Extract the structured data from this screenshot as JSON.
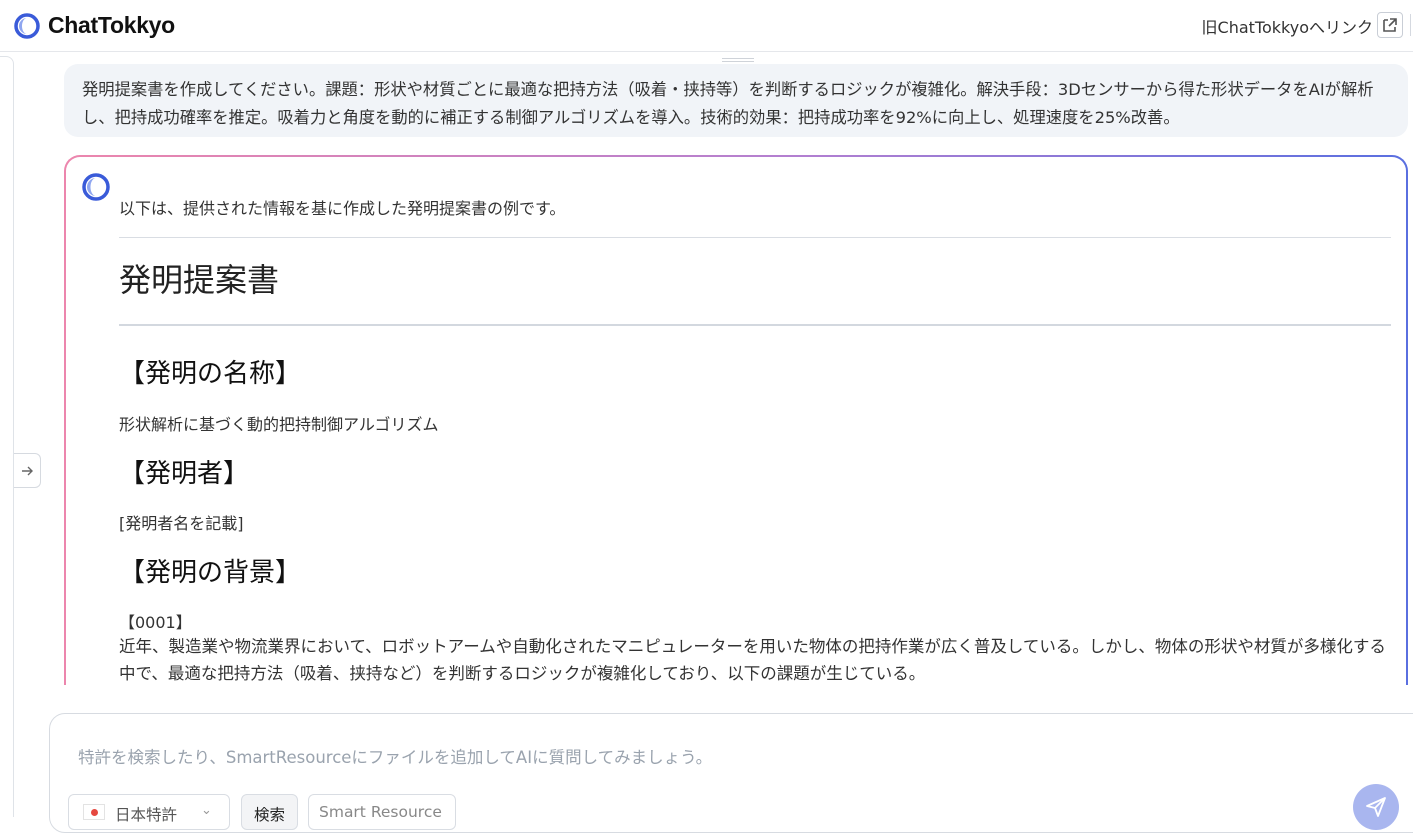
{
  "header": {
    "app_name": "ChatTokkyo",
    "old_link_label": "旧ChatTokkyoへリンク"
  },
  "user_message": {
    "text": "発明提案書を作成してください。課題：形状や材質ごとに最適な把持方法（吸着・挟持等）を判断するロジックが複雑化。解決手段：3Dセンサーから得た形状データをAIが解析し、把持成功確率を推定。吸着力と角度を動的に補正する制御アルゴリズムを導入。技術的効果：把持成功率を92%に向上し、処理速度を25%改善。"
  },
  "answer": {
    "intro": "以下は、提供された情報を基に作成した発明提案書の例です。",
    "title": "発明提案書",
    "sections": [
      {
        "heading": "【発明の名称】",
        "body": "形状解析に基づく動的把持制御アルゴリズム"
      },
      {
        "heading": "【発明者】",
        "body": "[発明者名を記載]"
      },
      {
        "heading": "【発明の背景】",
        "body": "【0001】"
      }
    ],
    "paragraph": "近年、製造業や物流業界において、ロボットアームや自動化されたマニピュレーターを用いた物体の把持作業が広く普及している。しかし、物体の形状や材質が多様化する中で、最適な把持方法（吸着、挟持など）を判断するロジックが複雑化しており、以下の課題が生じている。"
  },
  "composer": {
    "placeholder": "特許を検索したり、SmartResourceにファイルを追加してAIに質問してみましょう。",
    "source_select": "日本特許",
    "search_chip": "検索",
    "smart_resource_chip": "Smart Resource"
  },
  "icons": {
    "logo": "chattokkyo-logo-icon",
    "external": "external-link-icon",
    "expand": "arrow-right-icon",
    "send": "send-icon",
    "flag": "japan-flag-icon",
    "chevron": "chevron-down-icon"
  },
  "colors": {
    "accent_blue": "#3a5bd9",
    "gradient_pink": "#ec86ad",
    "gradient_blue": "#5a6fe0",
    "send_button": "#a9b6ef"
  }
}
